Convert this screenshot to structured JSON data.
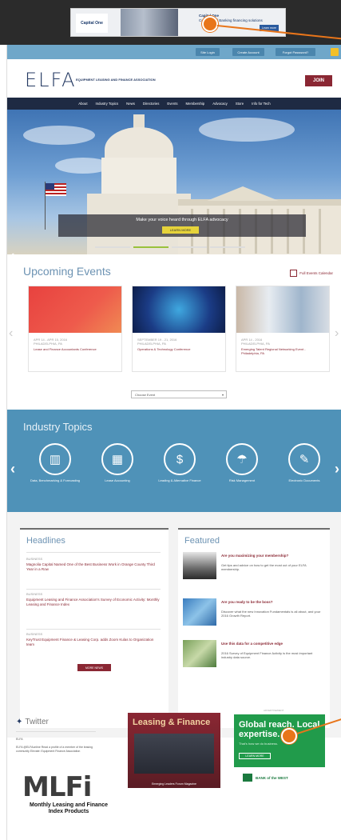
{
  "top_ad": {
    "brand": "Capital One",
    "headline": "Capital One",
    "body": "Commercial Banking financing solutions",
    "button": "Learn more"
  },
  "utility": {
    "buttons": [
      "Site Login",
      "Create Account",
      "Forgot Password?"
    ]
  },
  "header": {
    "logo": "ELFA",
    "logo_sub": "EQUIPMENT LEASING AND FINANCE ASSOCIATION",
    "join": "JOIN"
  },
  "nav": {
    "items": [
      "About",
      "Industry Topics",
      "News",
      "Directories",
      "Events",
      "Membership",
      "Advocacy",
      "Store",
      "Info for Tech"
    ]
  },
  "hero": {
    "caption": "Make your voice heard through ELFA advocacy",
    "cta": "LEARN MORE"
  },
  "events": {
    "title": "Upcoming Events",
    "calendar_link": "Full Events Calendar",
    "cards": [
      {
        "date": "APR 14 - APR 15, 2016",
        "place": "PHILADELPHIA, PA",
        "name": "Lease and Finance Accountants Conference",
        "color": "#e8423f"
      },
      {
        "date": "SEPTEMBER 19 - 21, 2016",
        "place": "PHILADELPHIA, PA",
        "name": "Operations & Technology Conference",
        "color": "#1b3c86"
      },
      {
        "date": "APR 14 - 2016",
        "place": "PHILADELPHIA, PA",
        "name": "Emerging Talent Regional Networking Event - Philadelphia, PA",
        "color": "#cfd8e0"
      }
    ],
    "select_label": "Choose Event"
  },
  "topics": {
    "title": "Industry Topics",
    "items": [
      {
        "icon": "bar-chart-icon",
        "glyph": "▥",
        "label": "Data, Benchmarking & Forecasting"
      },
      {
        "icon": "calculator-icon",
        "glyph": "▦",
        "label": "Lease Accounting"
      },
      {
        "icon": "money-icon",
        "glyph": "$",
        "label": "Leading & Alternative Finance"
      },
      {
        "icon": "umbrella-icon",
        "glyph": "☂",
        "label": "Risk Management"
      },
      {
        "icon": "document-icon",
        "glyph": "✎",
        "label": "Electronic Documents"
      }
    ]
  },
  "headlines": {
    "title": "Headlines",
    "items": [
      {
        "category": "BUSINESS",
        "text": "Magnolia Capital Named One of the Best Business Work in Orange County Third Year in a Row"
      },
      {
        "category": "BUSINESS",
        "text": "Equipment Leasing and Finance Association's Survey of Economic Activity: Monthly Leasing and Finance Index"
      },
      {
        "category": "BUSINESS",
        "text": "KeyTrust Equipment Finance & Leasing Corp. adds Zoom Kulas to Organization team"
      }
    ],
    "more": "MORE NEWS"
  },
  "featured": {
    "title": "Featured",
    "items": [
      {
        "title": "Are you maximizing your membership?",
        "desc": "Get tips and advice on how to get the most out of your ELFA membership."
      },
      {
        "title": "Are you ready to be the boss?",
        "desc": "Discover what the new Innovation Fundamentals is all about, and your 2016 Growth Report."
      },
      {
        "title": "Use this data for a competitive edge",
        "desc": "2016 Survey of Equipment Finance Activity is the most important industry data source."
      }
    ]
  },
  "twitter": {
    "title": "Twitter",
    "handle": "ELFA",
    "tweet": "ELFA @ELFAonline Read a profile of a member of the leasing community Elevate: Equipment Finance Association"
  },
  "mlfi": {
    "logo": "MLFi",
    "sub": "Monthly Leasing and Finance Index Products"
  },
  "magazine": {
    "title": "Leasing & Finance",
    "sub": "Emerging Leaders Forum Magazine"
  },
  "bnp_ad": {
    "label": "ADVERTISEMENT",
    "title": "Global reach. Local expertise.",
    "sub": "That's how we do business.",
    "button": "LEARN MORE",
    "logo": "BANK of the WEST"
  }
}
